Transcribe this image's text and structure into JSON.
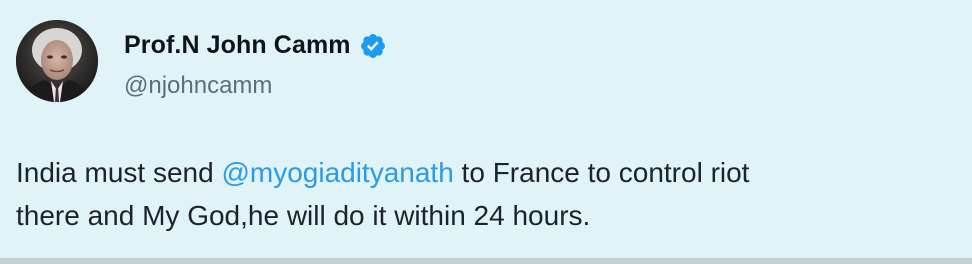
{
  "author": {
    "display_name": "Prof.N John Camm",
    "handle": "@njohncamm",
    "verified": true,
    "avatar_icon": "profile-photo"
  },
  "tweet": {
    "line1_prefix": "India must send ",
    "mention": "@myogiadityanath",
    "line1_suffix": " to France to control riot",
    "line2": "there and My God,he will do it within 24 hours."
  },
  "colors": {
    "background": "#dff3f8",
    "mention": "#2d9ae6",
    "verified_badge": "#1d9bf0"
  }
}
